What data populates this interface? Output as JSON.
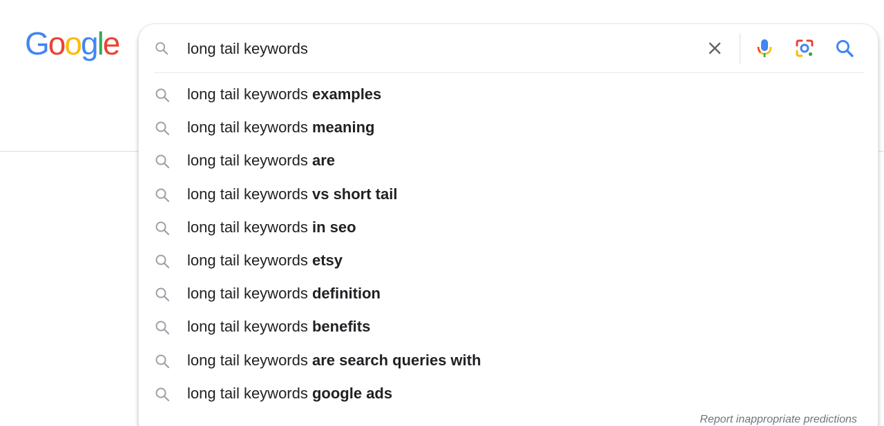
{
  "logo": {
    "letters": [
      "G",
      "o",
      "o",
      "g",
      "l",
      "e"
    ],
    "colors": [
      "#4285F4",
      "#EA4335",
      "#FBBC05",
      "#4285F4",
      "#34A853",
      "#EA4335"
    ]
  },
  "search": {
    "query": "long tail keywords",
    "clear_icon": "close-icon",
    "voice_icon": "microphone-icon",
    "lens_icon": "lens-camera-icon",
    "submit_icon": "search-icon"
  },
  "suggestions": [
    {
      "prefix": "long tail keywords ",
      "completion": "examples"
    },
    {
      "prefix": "long tail keywords ",
      "completion": "meaning"
    },
    {
      "prefix": "long tail keywords ",
      "completion": "are"
    },
    {
      "prefix": "long tail keywords ",
      "completion": "vs short tail"
    },
    {
      "prefix": "long tail keywords ",
      "completion": "in seo"
    },
    {
      "prefix": "long tail keywords ",
      "completion": "etsy"
    },
    {
      "prefix": "long tail keywords ",
      "completion": "definition"
    },
    {
      "prefix": "long tail keywords ",
      "completion": "benefits"
    },
    {
      "prefix": "long tail keywords ",
      "completion": "are search queries with"
    },
    {
      "prefix": "long tail keywords ",
      "completion": "google ads"
    }
  ],
  "footer": {
    "report_label": "Report inappropriate predictions"
  },
  "colors": {
    "text": "#202124",
    "icon_gray": "#9aa0a6",
    "accent_blue": "#4285F4"
  }
}
